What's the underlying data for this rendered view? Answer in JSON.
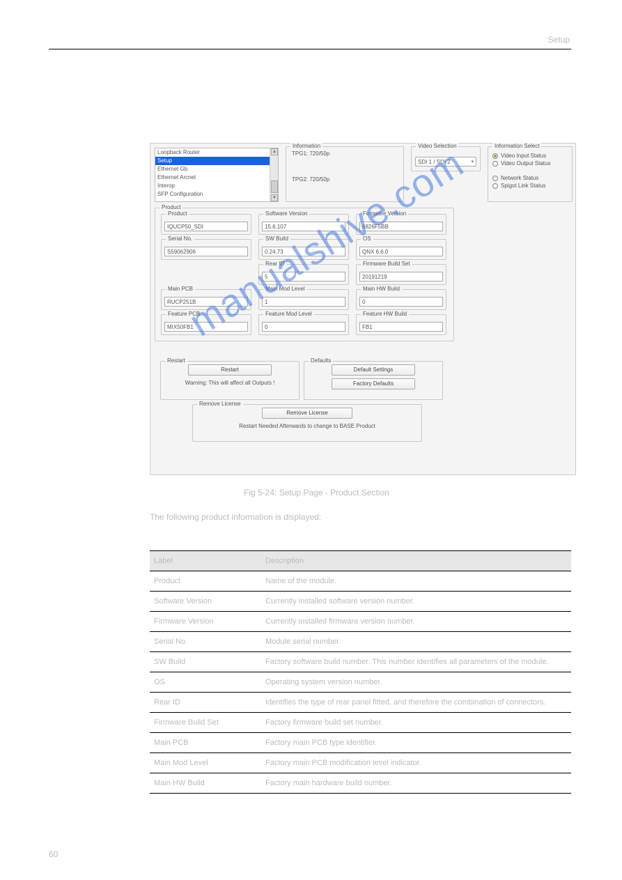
{
  "page_title_suffix": "Setup",
  "nav": {
    "items": [
      "Loopback Router",
      "Setup",
      "Ethernet Gb",
      "Ethernet Arcnet",
      "Interop",
      "SFP Configuration"
    ],
    "selected_index": 1
  },
  "information_box": {
    "label": "Information",
    "line1": "TPG1: 720/50p",
    "line2": "TPG2: 720/50p"
  },
  "video_selection": {
    "label": "Video Selection",
    "value": "SDI 1 / SDI 2"
  },
  "information_select": {
    "label": "Information Select",
    "options": [
      "Video Input Status",
      "Video Output Status",
      "Network Status",
      "Spigot Link Status"
    ],
    "selected_index": 0
  },
  "product_group_label": "Product",
  "fields": {
    "product": {
      "label": "Product",
      "value": "IQUCP50_SDI"
    },
    "software_ver": {
      "label": "Software Version",
      "value": "15.6.107"
    },
    "firmware_ver": {
      "label": "Firmware Version",
      "value": "6826F5BB"
    },
    "serial": {
      "label": "Serial No.",
      "value": "S59062906"
    },
    "sw_build": {
      "label": "SW Build",
      "value": "0.24.73"
    },
    "os": {
      "label": "OS",
      "value": "QNX 6.6.0"
    },
    "rear_id": {
      "label": "Rear ID",
      "value": "5"
    },
    "fw_build_set": {
      "label": "Firmware Build Set",
      "value": "20191219"
    },
    "main_pcb": {
      "label": "Main PCB",
      "value": "RUCP251B"
    },
    "main_mod": {
      "label": "Main Mod Level",
      "value": "1"
    },
    "main_hw": {
      "label": "Main HW Build",
      "value": "0"
    },
    "feature_pcb": {
      "label": "Feature PCB",
      "value": "MIX50FB1"
    },
    "feature_mod": {
      "label": "Feature Mod Level",
      "value": "0"
    },
    "feature_hw": {
      "label": "Feature HW Build",
      "value": "FB1"
    }
  },
  "restart": {
    "label": "Restart",
    "button": "Restart",
    "warning": "Warning: This will affect all Outputs !"
  },
  "defaults": {
    "label": "Defaults",
    "btn1": "Default Settings",
    "btn2": "Factory Defaults"
  },
  "remove": {
    "label": "Remove License",
    "button": "Remove License",
    "note": "Restart Needed Afterwards to change to BASE Product"
  },
  "watermark": "manualshive.com",
  "figure_caption": "Fig 5-24: Setup Page - Product Section",
  "paragraph": "The following product information is displayed:",
  "table": {
    "headers": [
      "Label",
      "Description"
    ],
    "rows": [
      [
        "Product",
        "Name of the module."
      ],
      [
        "Software Version",
        "Currently installed software version number."
      ],
      [
        "Firmware Version",
        "Currently installed firmware version number."
      ],
      [
        "Serial No",
        "Module serial number."
      ],
      [
        "SW Build",
        "Factory software build number. This number identifies all parameters of the module."
      ],
      [
        "OS",
        "Operating system version number."
      ],
      [
        "Rear ID",
        "Identifies the type of rear panel fitted, and therefore the combination of connectors."
      ],
      [
        "Firmware Build Set",
        "Factory firmware build set number."
      ],
      [
        "Main PCB",
        "Factory main PCB type identifier."
      ],
      [
        "Main Mod Level",
        "Factory main PCB modification level indicator."
      ],
      [
        "Main HW Build",
        "Factory main hardware build number."
      ]
    ]
  },
  "page_number": "60"
}
